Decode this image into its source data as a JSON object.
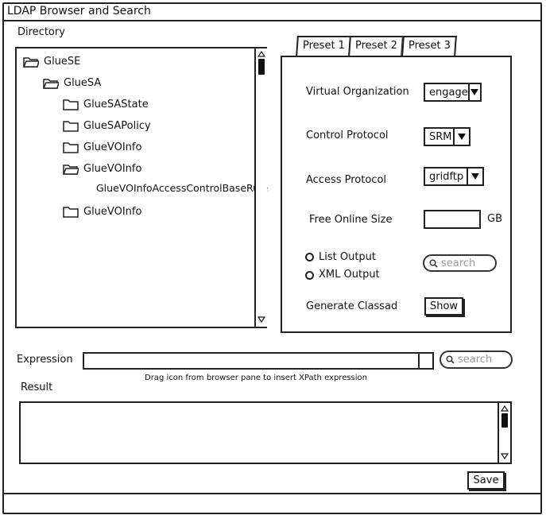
{
  "window": {
    "title": "LDAP Browser and Search"
  },
  "directory": {
    "label": "Directory",
    "tree": [
      {
        "label": "GlueSE",
        "icon": "folder-open-icon"
      },
      {
        "label": "GlueSA",
        "icon": "folder-open-icon"
      },
      {
        "label": "GlueSAState",
        "icon": "folder-icon"
      },
      {
        "label": "GlueSAPolicy",
        "icon": "folder-icon"
      },
      {
        "label": "GlueVOInfo",
        "icon": "folder-icon"
      },
      {
        "label": "GlueVOInfo",
        "icon": "folder-open-icon"
      },
      {
        "label": "GlueVOInfoAccessControlBaseRule",
        "icon": ""
      },
      {
        "label": "GlueVOInfo",
        "icon": "folder-icon"
      }
    ]
  },
  "tabs": [
    {
      "label": "Preset 1"
    },
    {
      "label": "Preset 2"
    },
    {
      "label": "Preset 3"
    }
  ],
  "form": {
    "vo_label": "Virtual Organization",
    "vo_value": "engage",
    "control_label": "Control Protocol",
    "control_value": "SRM",
    "access_label": "Access Protocol",
    "access_value": "gridftp",
    "size_label": "Free Online Size",
    "size_value": "",
    "size_unit": "GB",
    "list_output": "List Output",
    "xml_output": "XML Output",
    "search_placeholder": "search",
    "classad_label": "Generate Classad",
    "show_button": "Show"
  },
  "expression": {
    "label": "Expression",
    "value": "",
    "hint": "Drag icon from browser pane to insert XPath expression",
    "search_placeholder": "search"
  },
  "result": {
    "label": "Result",
    "value": ""
  },
  "save_button": "Save"
}
